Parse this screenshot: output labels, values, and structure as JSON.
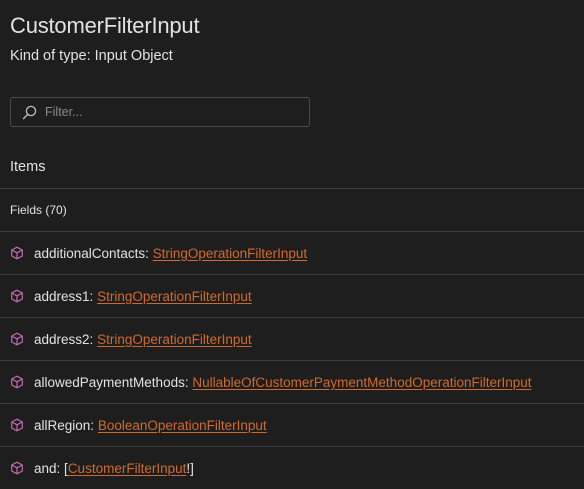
{
  "header": {
    "title": "CustomerFilterInput",
    "kind": "Kind of type: Input Object"
  },
  "filter": {
    "placeholder": "Filter..."
  },
  "items_label": "Items",
  "fields_header": "Fields (70)",
  "fields": [
    {
      "name": "additionalContacts",
      "prefix": "",
      "type": "StringOperationFilterInput",
      "suffix": ""
    },
    {
      "name": "address1",
      "prefix": "",
      "type": "StringOperationFilterInput",
      "suffix": ""
    },
    {
      "name": "address2",
      "prefix": "",
      "type": "StringOperationFilterInput",
      "suffix": ""
    },
    {
      "name": "allowedPaymentMethods",
      "prefix": "",
      "type": "NullableOfCustomerPaymentMethodOperationFilterInput",
      "suffix": ""
    },
    {
      "name": "allRegion",
      "prefix": "",
      "type": "BooleanOperationFilterInput",
      "suffix": ""
    },
    {
      "name": "and",
      "prefix": "[",
      "type": "CustomerFilterInput",
      "suffix": "!]"
    }
  ],
  "colors": {
    "background": "#1e1e1e",
    "link": "#cf6a2e",
    "cube_icon": "#c06bb0",
    "divider": "#3c3c3c"
  },
  "icons": {
    "filter": "search-icon",
    "field": "cube-icon"
  }
}
